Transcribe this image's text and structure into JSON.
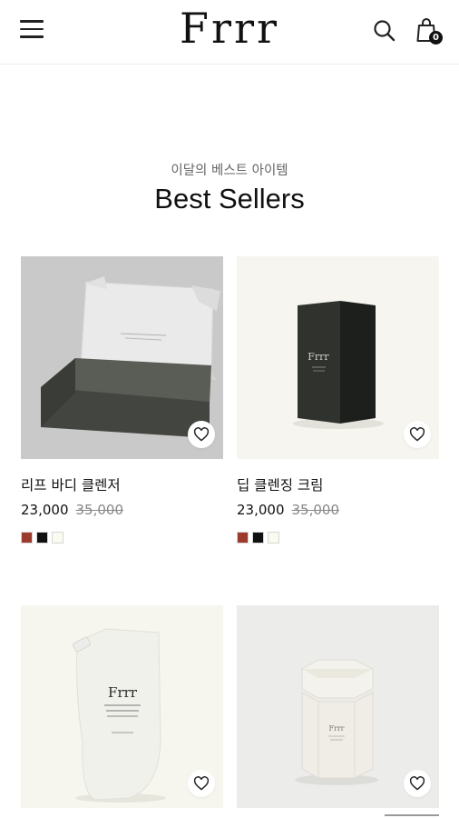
{
  "header": {
    "logo": "Frrr",
    "cart_count": "0"
  },
  "section": {
    "subtitle": "이달의 베스트 아이템",
    "title": "Best Sellers"
  },
  "products": [
    {
      "name": "리프 바디 클렌저",
      "price": "23,000",
      "original_price": "35,000",
      "swatches": [
        "#9c3b2c",
        "#111111",
        "#fafaf0"
      ]
    },
    {
      "name": "딥 클렌징 크림",
      "price": "23,000",
      "original_price": "35,000",
      "swatches": [
        "#9c3b2c",
        "#111111",
        "#fafaf0"
      ]
    },
    {
      "name": "",
      "price": "",
      "original_price": "",
      "swatches": []
    },
    {
      "name": "",
      "price": "",
      "original_price": "",
      "swatches": []
    }
  ],
  "product_labels": {
    "box_brand": "Frrr",
    "pouch_brand": "Frrr",
    "jar_brand": "Frrr"
  },
  "icons": [
    "menu-icon",
    "search-icon",
    "shopping-bag-icon",
    "heart-icon"
  ],
  "colors": {
    "text": "#111111",
    "muted": "#888888",
    "accent_red": "#9c3b2c"
  }
}
